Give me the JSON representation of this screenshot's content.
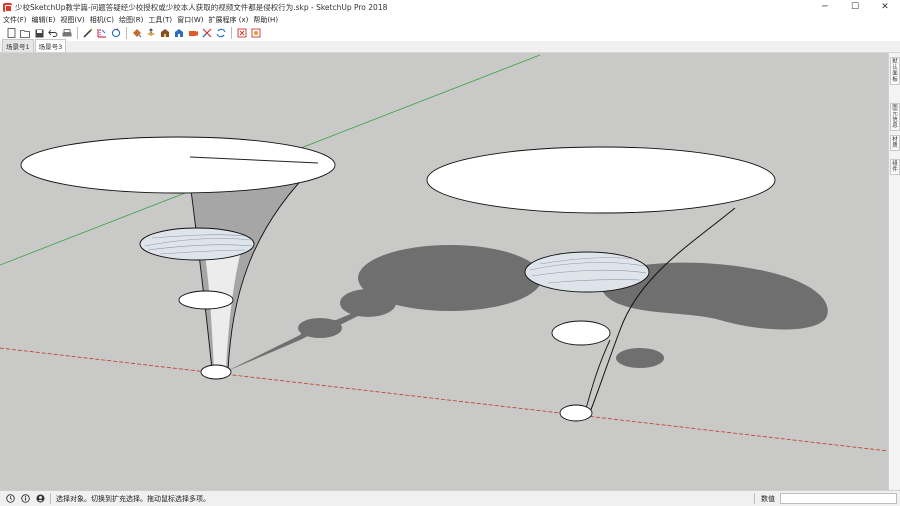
{
  "window": {
    "title": "少校SketchUp教学篇-问题答疑经少校授权或少校本人获取的视频文件都是侵权行为.skp - SketchUp Pro 2018",
    "controls": {
      "minimize": "─",
      "maximize": "☐",
      "close": "✕"
    }
  },
  "menu": [
    {
      "label": "文件(F)"
    },
    {
      "label": "编辑(E)"
    },
    {
      "label": "视图(V)"
    },
    {
      "label": "相机(C)"
    },
    {
      "label": "绘图(R)"
    },
    {
      "label": "工具(T)"
    },
    {
      "label": "窗口(W)"
    },
    {
      "label": "扩展程序 (x)"
    },
    {
      "label": "帮助(H)"
    }
  ],
  "toolbar": [
    {
      "name": "new-file-icon"
    },
    {
      "name": "open-file-icon"
    },
    {
      "name": "save-icon"
    },
    {
      "name": "undo-icon"
    },
    {
      "name": "print-icon"
    },
    {
      "name": "line-tool-icon"
    },
    {
      "name": "measure-tool-icon"
    },
    {
      "name": "rotate-icon"
    },
    {
      "name": "paint-bucket-icon"
    },
    {
      "name": "push-pull-icon"
    },
    {
      "name": "warehouse-icon"
    },
    {
      "name": "extension-warehouse-icon"
    },
    {
      "name": "camera-icon"
    },
    {
      "name": "cut-icon"
    },
    {
      "name": "sync-icon"
    },
    {
      "name": "ruby-console-icon"
    },
    {
      "name": "plugin-icon"
    }
  ],
  "scene_tabs": [
    {
      "label": "场景号1",
      "active": false
    },
    {
      "label": "场景号3",
      "active": true
    }
  ],
  "tray": [
    {
      "label": "默认面板"
    },
    {
      "label": "图元信息"
    },
    {
      "label": "材质"
    },
    {
      "label": "组件"
    }
  ],
  "status": {
    "message": "选择对象。切换到扩充选择。拖动鼠标选择多项。",
    "measure_label": "数值",
    "measure_value": ""
  },
  "colors": {
    "viewport_bg": "#c9c9c7",
    "shadow": "#6f6f6f",
    "red_axis": "#c0392b",
    "green_axis": "#3aa04a",
    "surface_gray": "#a6a6a6"
  }
}
